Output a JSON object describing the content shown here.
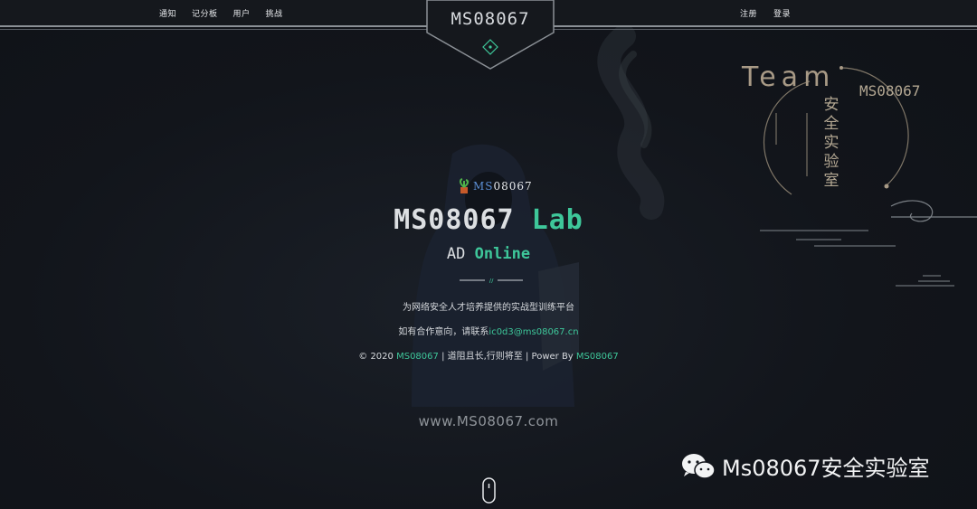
{
  "nav": {
    "left": [
      "通知",
      "记分板",
      "用户",
      "挑战"
    ],
    "right": [
      "注册",
      "登录"
    ]
  },
  "badge": {
    "text": "MS08067"
  },
  "team_logo": {
    "word": "Team",
    "cn": "安全实验室",
    "ms": "MS08067"
  },
  "hero": {
    "logo_prefix": "MS",
    "logo_suffix": "08067",
    "title_main": "MS08067",
    "title_accent": "Lab",
    "subtitle_main": "AD",
    "subtitle_accent": "Online",
    "divider_mark": "//",
    "tagline": "为网络安全人才培养提供的实战型训练平台",
    "contact_prefix": "如有合作意向，请联系",
    "contact_email": "ic0d3@ms08067.cn",
    "footer_copy": "© 2020",
    "footer_brand1": "MS08067",
    "footer_mid": "| 道阻且长,行则将至 | Power By",
    "footer_brand2": "MS08067",
    "website": "www.MS08067.com"
  },
  "watermark": {
    "text": "Ms08067安全实验室"
  },
  "colors": {
    "accent": "#3ec79a",
    "background": "#12151b",
    "team_gold": "#a89a86"
  }
}
